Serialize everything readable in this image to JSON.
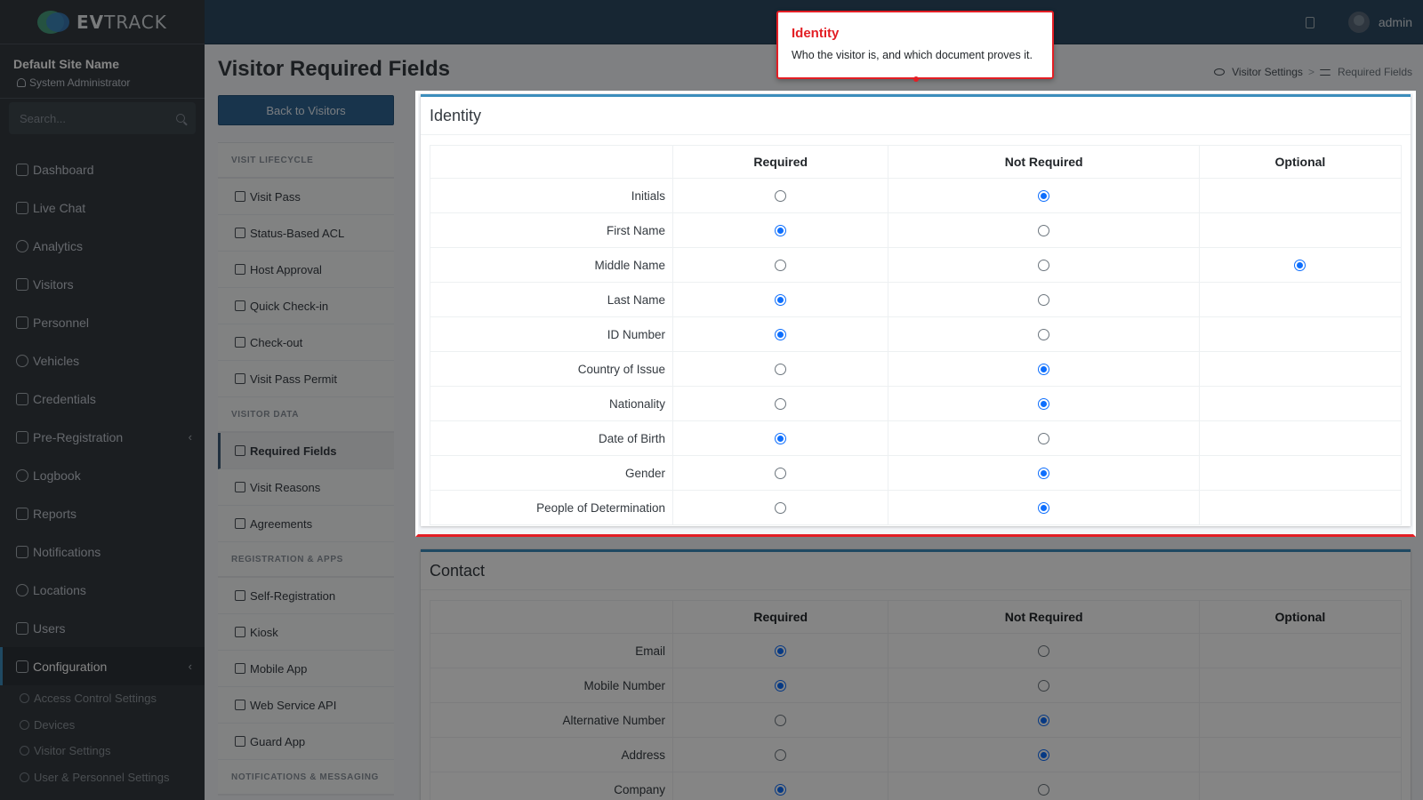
{
  "app": {
    "brand_prefix": "EV",
    "brand_suffix": "TRACK"
  },
  "user_panel": {
    "site_name": "Default Site Name",
    "role": "System Administrator"
  },
  "search": {
    "placeholder": "Search..."
  },
  "nav": [
    {
      "label": "Dashboard",
      "icon": "dashboard-icon"
    },
    {
      "label": "Live Chat",
      "icon": "headset-icon"
    },
    {
      "label": "Analytics",
      "icon": "analytics-icon"
    },
    {
      "label": "Visitors",
      "icon": "eye-icon"
    },
    {
      "label": "Personnel",
      "icon": "personnel-icon"
    },
    {
      "label": "Vehicles",
      "icon": "car-icon"
    },
    {
      "label": "Credentials",
      "icon": "id-card-icon"
    },
    {
      "label": "Pre-Registration",
      "icon": "arrows-icon"
    },
    {
      "label": "Logbook",
      "icon": "book-icon"
    },
    {
      "label": "Reports",
      "icon": "reports-icon"
    },
    {
      "label": "Notifications",
      "icon": "chat-icon"
    },
    {
      "label": "Locations",
      "icon": "building-icon"
    },
    {
      "label": "Users",
      "icon": "users-icon"
    },
    {
      "label": "Configuration",
      "icon": "gear-icon"
    }
  ],
  "subnav": [
    {
      "label": "Access Control Settings"
    },
    {
      "label": "Devices"
    },
    {
      "label": "Visitor Settings"
    },
    {
      "label": "User & Personnel Settings"
    }
  ],
  "topbar": {
    "username": "admin"
  },
  "page": {
    "title": "Visitor Required Fields"
  },
  "breadcrumb": {
    "parent": "Visitor Settings",
    "separator": ">",
    "current": "Required Fields"
  },
  "settings_menu": {
    "back_label": "Back to Visitors",
    "sections": [
      {
        "heading": "VISIT LIFECYCLE",
        "items": [
          "Visit Pass",
          "Status-Based ACL",
          "Host Approval",
          "Quick Check-in",
          "Check-out",
          "Visit Pass Permit"
        ]
      },
      {
        "heading": "VISITOR DATA",
        "items": [
          "Required Fields",
          "Visit Reasons",
          "Agreements"
        ]
      },
      {
        "heading": "REGISTRATION & APPS",
        "items": [
          "Self-Registration",
          "Kiosk",
          "Mobile App",
          "Web Service API",
          "Guard App"
        ]
      },
      {
        "heading": "NOTIFICATIONS & MESSAGING",
        "items": []
      }
    ]
  },
  "columns": {
    "required": "Required",
    "not_required": "Not Required",
    "optional": "Optional"
  },
  "identity": {
    "title": "Identity",
    "rows": [
      {
        "label": "Initials",
        "value": "not_required"
      },
      {
        "label": "First Name",
        "value": "required"
      },
      {
        "label": "Middle Name",
        "value": "optional"
      },
      {
        "label": "Last Name",
        "value": "required"
      },
      {
        "label": "ID Number",
        "value": "required"
      },
      {
        "label": "Country of Issue",
        "value": "not_required"
      },
      {
        "label": "Nationality",
        "value": "not_required"
      },
      {
        "label": "Date of Birth",
        "value": "required"
      },
      {
        "label": "Gender",
        "value": "not_required"
      },
      {
        "label": "People of Determination",
        "value": "not_required"
      }
    ]
  },
  "contact": {
    "title": "Contact",
    "rows": [
      {
        "label": "Email",
        "value": "required"
      },
      {
        "label": "Mobile Number",
        "value": "required"
      },
      {
        "label": "Alternative Number",
        "value": "not_required"
      },
      {
        "label": "Address",
        "value": "not_required"
      },
      {
        "label": "Company",
        "value": "required"
      }
    ]
  },
  "tooltip": {
    "title": "Identity",
    "text": "Who the visitor is, and which document proves it."
  },
  "colors": {
    "sidebar": "#343a40",
    "topbar": "#2c4a63",
    "accent": "#3c8dbc",
    "radio": "#0d6efd",
    "tour_highlight": "#e31e24"
  }
}
